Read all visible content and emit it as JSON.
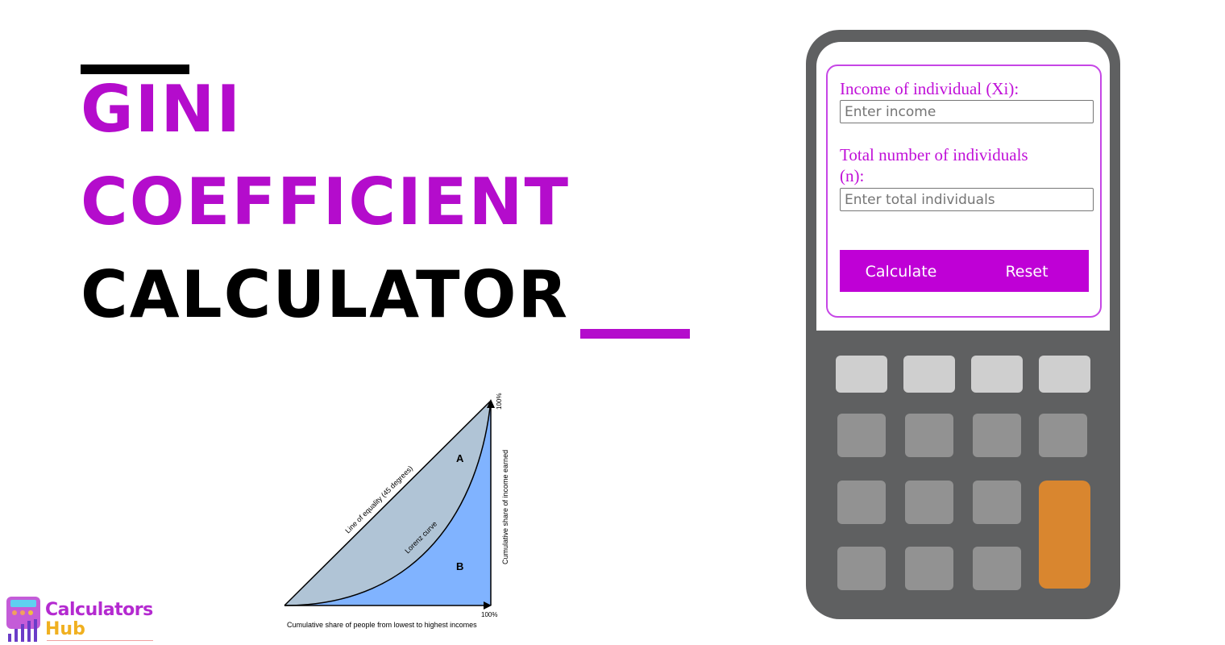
{
  "title": {
    "line1": "GINI",
    "line2": "COEFFICIENT",
    "line3": "CALCULATOR"
  },
  "colors": {
    "accent": "#b40ccc",
    "calculator_body": "#5f6061",
    "orange_key": "#d9862f",
    "button": "#bf00d6"
  },
  "form": {
    "income_label": "Income of individual (Xi):",
    "income_placeholder": "Enter income",
    "total_label_1": "Total number of individuals",
    "total_label_2": "(n):",
    "total_placeholder": "Enter total individuals",
    "calculate_label": "Calculate",
    "reset_label": "Reset"
  },
  "diagram": {
    "equality_label": "Line of equality (45 degrees)",
    "lorenz_label": "Lorenz curve",
    "area_a": "A",
    "area_b": "B",
    "x_axis_label": "Cumulative share of people from lowest to highest incomes",
    "y_axis_label": "Cumulative share of income earned",
    "x_max": "100%",
    "y_max": "100%"
  },
  "logo": {
    "line1": "Calculators",
    "line2": "Hub"
  }
}
